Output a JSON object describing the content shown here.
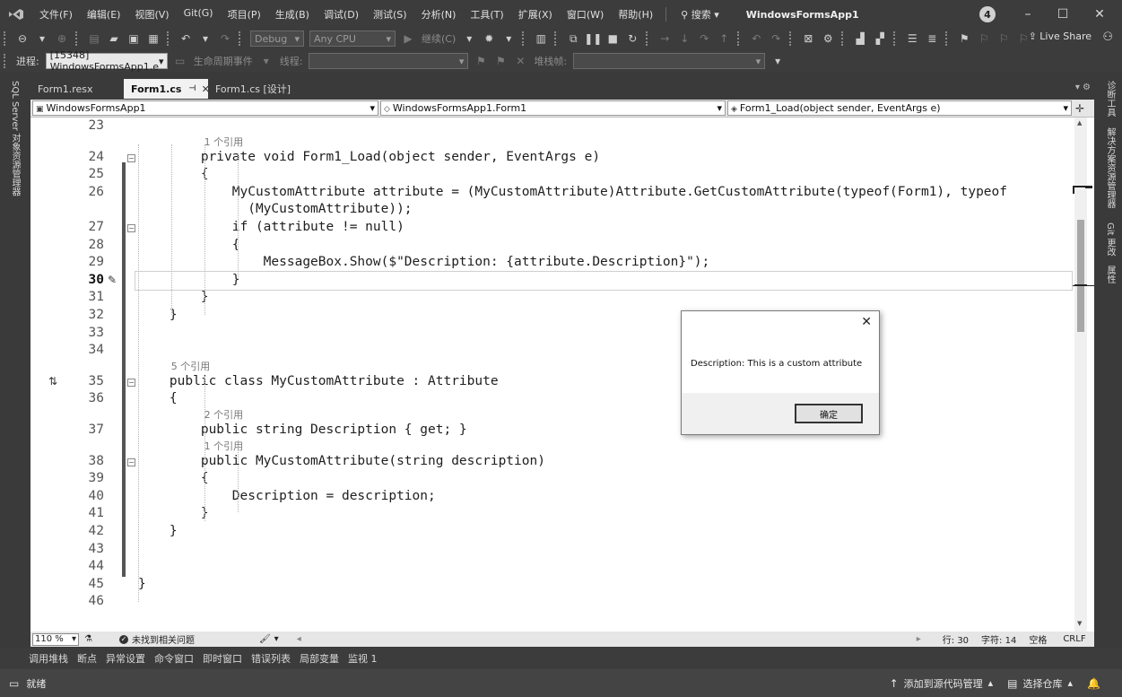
{
  "menubar": {
    "logo_icon": "visual-studio-logo-icon",
    "items": [
      "文件(F)",
      "编辑(E)",
      "视图(V)",
      "Git(G)",
      "项目(P)",
      "生成(B)",
      "调试(D)",
      "测试(S)",
      "分析(N)",
      "工具(T)",
      "扩展(X)",
      "窗口(W)",
      "帮助(H)"
    ],
    "search_label": "搜索",
    "window_title": "WindowsFormsApp1",
    "notification_count": "4"
  },
  "toolbar1": {
    "config_combo": "Debug",
    "platform_combo": "Any CPU",
    "continue_label": "继续(C)",
    "live_share_label": "Live Share"
  },
  "toolbar2": {
    "process_label": "进程:",
    "process_value": "[15348] WindowsFormsApp1.e",
    "lifecycle_label": "生命周期事件",
    "thread_label": "线程:",
    "stackframe_label": "堆栈帧:"
  },
  "left_strip": {
    "label": "SQL Server 对象资源管理器"
  },
  "right_strip": {
    "items": [
      "诊断工具",
      "解决方案资源管理器",
      "Git 更改",
      "属性"
    ]
  },
  "tabs": [
    {
      "label": "Form1.resx",
      "active": false
    },
    {
      "label": "Form1.cs",
      "active": true
    },
    {
      "label": "Form1.cs [设计]",
      "active": false
    }
  ],
  "navbar": {
    "project": "WindowsFormsApp1",
    "class": "WindowsFormsApp1.Form1",
    "member": "Form1_Load(object sender, EventArgs e)"
  },
  "code": {
    "current_line": "30",
    "lines": [
      {
        "n": "23",
        "text": ""
      },
      {
        "n": "24",
        "text": "        private void Form1_Load(object sender, EventArgs e)",
        "lens": "1 个引用"
      },
      {
        "n": "25",
        "text": "        {"
      },
      {
        "n": "26",
        "text": "            MyCustomAttribute attribute = (MyCustomAttribute)Attribute.GetCustomAttribute(typeof(Form1), typeof"
      },
      {
        "n": "",
        "text": "              (MyCustomAttribute));"
      },
      {
        "n": "27",
        "text": "            if (attribute != null)"
      },
      {
        "n": "28",
        "text": "            {"
      },
      {
        "n": "29",
        "text": "                MessageBox.Show($\"Description: {attribute.Description}\");"
      },
      {
        "n": "30",
        "text": "            }"
      },
      {
        "n": "31",
        "text": "        }"
      },
      {
        "n": "32",
        "text": "    }"
      },
      {
        "n": "33",
        "text": ""
      },
      {
        "n": "34",
        "text": ""
      },
      {
        "n": "35",
        "text": "    public class MyCustomAttribute : Attribute",
        "lens": "5 个引用"
      },
      {
        "n": "36",
        "text": "    {"
      },
      {
        "n": "37",
        "text": "        public string Description { get; }",
        "lens": "2 个引用"
      },
      {
        "n": "38",
        "text": "        public MyCustomAttribute(string description)",
        "lens": "1 个引用"
      },
      {
        "n": "39",
        "text": "        {"
      },
      {
        "n": "40",
        "text": "            Description = description;"
      },
      {
        "n": "41",
        "text": "        }"
      },
      {
        "n": "42",
        "text": "    }"
      },
      {
        "n": "43",
        "text": ""
      },
      {
        "n": "44",
        "text": ""
      },
      {
        "n": "45",
        "text": "}"
      },
      {
        "n": "46",
        "text": ""
      }
    ]
  },
  "dialog": {
    "message": "Description: This is a custom attribute",
    "ok_label": "确定",
    "close_glyph": "✕"
  },
  "editor_status": {
    "zoom": "110 %",
    "issues": "未找到相关问题",
    "line": "行: 30",
    "char": "字符: 14",
    "whitespace": "空格",
    "eol": "CRLF"
  },
  "tool_windows": [
    "调用堆栈",
    "断点",
    "异常设置",
    "命令窗口",
    "即时窗口",
    "错误列表",
    "局部变量",
    "监视 1"
  ],
  "statusbar": {
    "ready": "就绪",
    "add_source_control": "添加到源代码管理",
    "select_repo": "选择仓库"
  }
}
